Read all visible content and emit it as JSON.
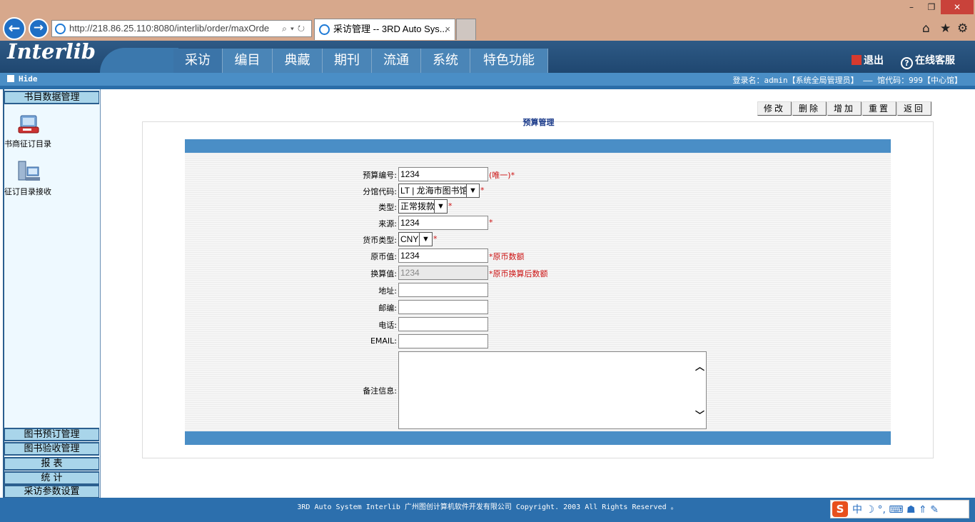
{
  "browser": {
    "url": "http://218.86.25.110:8080/interlib/order/maxOrde",
    "tab_title": "采访管理 -- 3RD Auto Sys...",
    "tab_close": "×",
    "window_controls": {
      "minimize": "–",
      "maximize": "❐",
      "close": "✕"
    },
    "back": "←",
    "forward": "→",
    "address_controls": "⌕▾↻",
    "toolbar_icons": {
      "home": "⌂",
      "favorites": "★",
      "settings": "⚙"
    }
  },
  "app": {
    "logo": "Interlib",
    "nav": [
      "采访",
      "编目",
      "典藏",
      "期刊",
      "流通",
      "系统",
      "特色功能"
    ],
    "active_nav": "采访",
    "exit_label": "退出",
    "service_label": "在线客服",
    "hide_label": "Hide",
    "login_info": "登录名：admin【系统全局管理员】 —— 馆代码：999【中心馆】"
  },
  "sidebar": {
    "top_header": "书目数据管理",
    "items": [
      {
        "label": "书商征订目录",
        "icon": "computer-icon"
      },
      {
        "label": "征订目录接收",
        "icon": "network-icon"
      }
    ],
    "bottom_headers": [
      "图书预订管理",
      "图书验收管理",
      "报 表",
      "统 计",
      "采访参数设置"
    ]
  },
  "toolbar": {
    "buttons": [
      "修改",
      "删除",
      "增加",
      "重置",
      "返回"
    ]
  },
  "page_title": "预算管理",
  "form": {
    "budget_no": {
      "label": "预算编号:",
      "value": "1234",
      "note": "(唯一)*"
    },
    "branch": {
      "label": "分馆代码:",
      "value": "LT | 龙海市图书馆",
      "note": "*"
    },
    "type": {
      "label": "类型:",
      "value": "正常拨款",
      "note": "*"
    },
    "source": {
      "label": "来源:",
      "value": "1234",
      "note": "*"
    },
    "currency": {
      "label": "货币类型:",
      "value": "CNY",
      "note": "*"
    },
    "original_value": {
      "label": "原币值:",
      "value": "1234",
      "note": "*原币数额"
    },
    "converted_value": {
      "label": "换算值:",
      "value": "1234",
      "note": "*原币换算后数额"
    },
    "address": {
      "label": "地址:",
      "value": ""
    },
    "postcode": {
      "label": "邮编:",
      "value": ""
    },
    "phone": {
      "label": "电话:",
      "value": ""
    },
    "email": {
      "label": "EMAIL:",
      "value": ""
    },
    "remark": {
      "label": "备注信息:",
      "value": ""
    }
  },
  "footer": {
    "copyright": "3RD Auto System Interlib 广州图创计算机软件开发有限公司 Copyright. 2003 All Rights Reserved 。",
    "ime_logo": "S",
    "ime_label": "中 ☽ °, ⌨ ☗ ⇑ ✎"
  }
}
